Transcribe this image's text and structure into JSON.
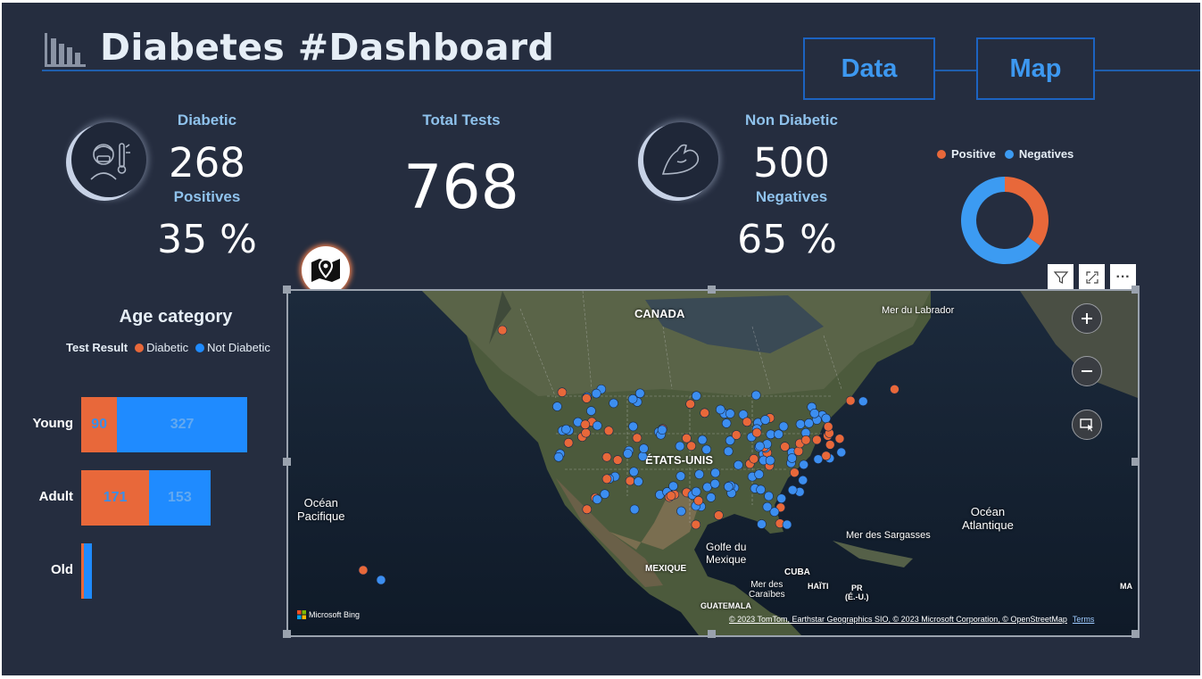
{
  "header": {
    "title": "Diabetes #Dashboard"
  },
  "nav": {
    "data_label": "Data",
    "map_label": "Map"
  },
  "kpis": {
    "diabetic": {
      "label": "Diabetic",
      "value": "268",
      "sub_label": "Positives",
      "percent": "35 %"
    },
    "total": {
      "label": "Total Tests",
      "value": "768"
    },
    "non_diabetic": {
      "label": "Non Diabetic",
      "value": "500",
      "sub_label": "Negatives",
      "percent": "65 %"
    }
  },
  "donut": {
    "legend": [
      {
        "label": "Positive",
        "color": "#e8683a"
      },
      {
        "label": "Negatives",
        "color": "#3c9bf2"
      }
    ],
    "values": [
      268,
      500
    ]
  },
  "age_chart": {
    "title": "Age category",
    "legend_title": "Test Result",
    "legend": [
      {
        "label": "Diabetic",
        "color": "#e8683a"
      },
      {
        "label": "Not Diabetic",
        "color": "#1f8bff"
      }
    ],
    "rows": [
      {
        "category": "Young",
        "diabetic": 90,
        "not_diabetic": 327,
        "diabetic_label": "90",
        "not_diabetic_label": "327"
      },
      {
        "category": "Adult",
        "diabetic": 171,
        "not_diabetic": 153,
        "diabetic_label": "171",
        "not_diabetic_label": "153"
      },
      {
        "category": "Old",
        "diabetic": 7,
        "not_diabetic": 20,
        "diabetic_label": "",
        "not_diabetic_label": ""
      }
    ]
  },
  "chart_data": {
    "type": "bar",
    "orientation": "horizontal",
    "stacked": true,
    "title": "Age category",
    "legend_title": "Test Result",
    "categories": [
      "Young",
      "Adult",
      "Old"
    ],
    "series": [
      {
        "name": "Diabetic",
        "values": [
          90,
          171,
          7
        ],
        "color": "#e8683a"
      },
      {
        "name": "Not Diabetic",
        "values": [
          327,
          153,
          20
        ],
        "color": "#1f8bff"
      }
    ]
  },
  "map": {
    "labels": {
      "canada": "CANADA",
      "labrador": "Mer du Labrador",
      "usa": "ÉTATS-UNIS",
      "pacific": "Océan\nPacifique",
      "atlantic": "Océan\nAtlantique",
      "sargasso": "Mer des Sargasses",
      "gulf": "Golfe du\nMexique",
      "mexico": "MEXIQUE",
      "cuba": "CUBA",
      "haiti": "HAÏTI",
      "pr": "PR\n(É.-U.)",
      "caribbean": "Mer des\nCaraïbes",
      "guatemala": "GUATEMALA",
      "ma": "MA"
    },
    "bing": "Microsoft Bing",
    "attribution": "© 2023 TomTom, Earthstar Geographics SIO, © 2023 Microsoft Corporation, © OpenStreetMap",
    "terms": "Terms",
    "colors": {
      "diabetic": "#e8683a",
      "not_diabetic": "#3c8ef0"
    }
  },
  "toolbar": {
    "filter_icon": "filter-icon",
    "focus_icon": "focus-mode-icon",
    "more_label": "···"
  }
}
